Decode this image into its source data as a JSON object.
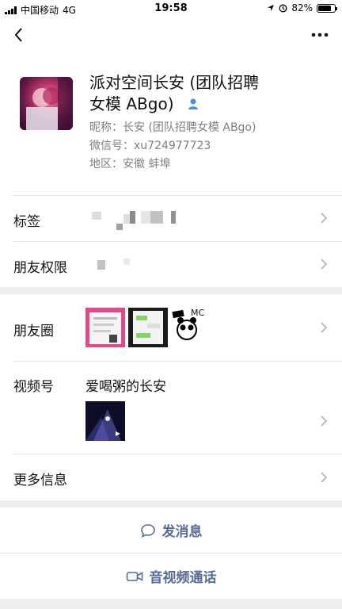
{
  "status_bar": {
    "carrier": "中国移动",
    "network": "4G",
    "time": "19:58",
    "battery_percent": "82%",
    "battery_level": 0.82
  },
  "nav": {
    "back_icon": "chevron-left-icon",
    "more_icon": "more-dots-icon"
  },
  "profile": {
    "name": "派对空间长安 (团队招聘女模 ABgo)",
    "name_line1": "派对空间长安 (团队招聘",
    "name_line2": "女模 ABgo)",
    "remark": "昵称：长安 (团队招聘女模 ABgo)",
    "wechat_id": "微信号：xu724977723",
    "region": "地区：安徽  蚌埠",
    "verify_icon": "person-icon",
    "accent": "#4a90e2"
  },
  "rows": {
    "tags": {
      "label": "标签"
    },
    "permissions": {
      "label": "朋友权限"
    },
    "moments": {
      "label": "朋友圈",
      "mc_text": "MC"
    },
    "channels": {
      "label": "视频号",
      "channel_name": "爱喝粥的长安"
    },
    "more_info": {
      "label": "更多信息"
    }
  },
  "actions": {
    "message": {
      "label": "发消息",
      "icon": "chat-bubble-icon"
    },
    "call": {
      "label": "音视频通话",
      "icon": "video-camera-icon"
    }
  },
  "colors": {
    "link": "#576b95",
    "background": "#ededed"
  }
}
